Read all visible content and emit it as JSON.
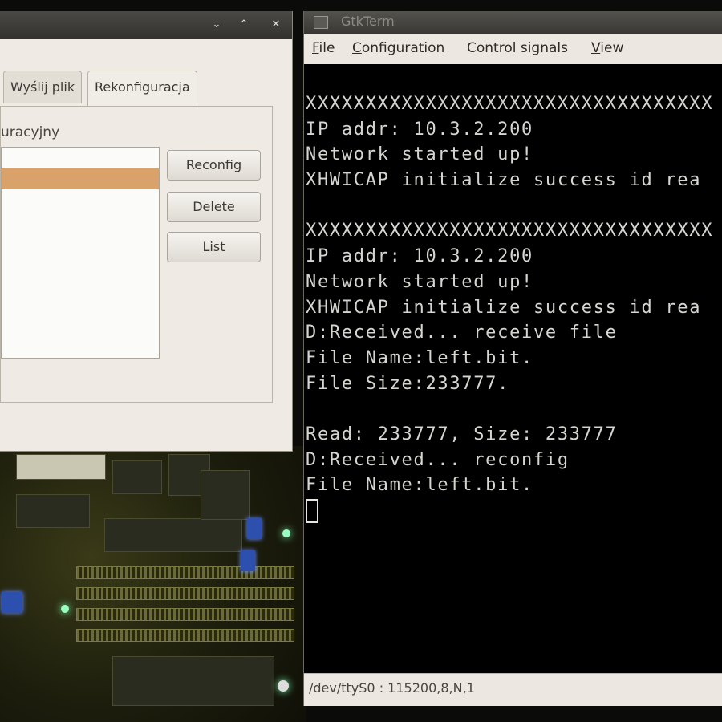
{
  "left_window": {
    "tabs": [
      {
        "label": "Wyślij plik",
        "active": false
      },
      {
        "label": "Rekonfiguracja",
        "active": true
      }
    ],
    "group_label": "uracyjny",
    "buttons": {
      "reconfig": "Reconfig",
      "delete": "Delete",
      "list": "List"
    },
    "title_buttons": {
      "min": "⌄",
      "max": "⌃",
      "close": "✕"
    }
  },
  "terminal_window": {
    "title": "GtkTerm",
    "menu": [
      {
        "u": "F",
        "rest": "ile"
      },
      {
        "u": "C",
        "rest": "onfiguration"
      },
      {
        "u": "",
        "rest": "Control signals"
      },
      {
        "u": "V",
        "rest": "iew"
      }
    ],
    "lines": [
      "XXXXXXXXXXXXXXXXXXXXXXXXXXXXXXXXXX",
      "IP addr: 10.3.2.200",
      "Network started up!",
      "XHWICAP initialize success id rea",
      "",
      "XXXXXXXXXXXXXXXXXXXXXXXXXXXXXXXXXX",
      "IP addr: 10.3.2.200",
      "Network started up!",
      "XHWICAP initialize success id rea",
      "D:Received... receive file",
      "File Name:left.bit.",
      "File Size:233777.",
      "",
      "Read: 233777, Size: 233777",
      "D:Received... reconfig",
      "File Name:left.bit."
    ],
    "status": "/dev/ttyS0 : 115200,8,N,1"
  },
  "colors": {
    "selection": "#d9a26a",
    "terminal_bg": "#000000",
    "terminal_fg": "#d6d6d0"
  }
}
